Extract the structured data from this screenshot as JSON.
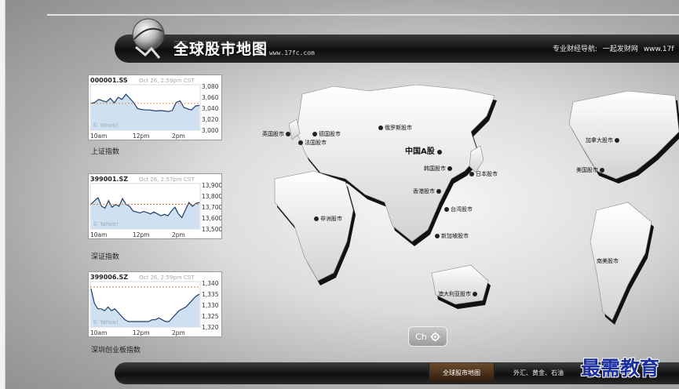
{
  "header": {
    "title": "全球股市地图",
    "url": "www.17fc.com",
    "nav_label": "专业财经导航:",
    "nav_link": "一起发财网",
    "nav_url_fragment": "www.17f"
  },
  "widgets": [
    {
      "code": "000001.SS",
      "timestamp": "Oct 26, 2:59pm CST",
      "caption": "上证指数",
      "source": "© Yahoo!",
      "y_ticks": [
        "3,080",
        "3,060",
        "3,040",
        "3,020",
        "3,000"
      ],
      "x_ticks": [
        "10am",
        "12pm",
        "2pm"
      ],
      "ref_value": 3048,
      "ylim": [
        2995,
        3085
      ],
      "series": [
        3048,
        3050,
        3056,
        3053,
        3051,
        3058,
        3049,
        3060,
        3056,
        3066,
        3058,
        3050,
        3038,
        3036,
        3035,
        3035,
        3034,
        3033,
        3034,
        3033,
        3032,
        3034,
        3050,
        3053,
        3040,
        3037,
        3035,
        3043,
        3044
      ]
    },
    {
      "code": "399001.SZ",
      "timestamp": "Oct 26, 2:57pm CST",
      "caption": "深证指数",
      "source": "© Yahoo!",
      "y_ticks": [
        "13,900",
        "13,800",
        "13,700",
        "13,600",
        "13,500"
      ],
      "x_ticks": [
        "10am",
        "12pm",
        "2pm"
      ],
      "ref_value": 13720,
      "ylim": [
        13460,
        13940
      ],
      "series": [
        13720,
        13760,
        13790,
        13700,
        13680,
        13760,
        13690,
        13720,
        13700,
        13780,
        13720,
        13700,
        13650,
        13640,
        13630,
        13645,
        13635,
        13620,
        13640,
        13620,
        13600,
        13615,
        13600,
        13650,
        13690,
        13620,
        13580,
        13660,
        13740,
        13700,
        13730,
        13740
      ]
    },
    {
      "code": "399006.SZ",
      "timestamp": "Oct 26, 2:59pm CST",
      "caption": "深圳创业板指数",
      "source": "© Yahoo!",
      "y_ticks": [
        "1,340",
        "1,335",
        "1,330",
        "1,325",
        "1,320"
      ],
      "x_ticks": [
        "10am",
        "12pm",
        "2pm"
      ],
      "ref_value": 1339,
      "ylim": [
        1317,
        1342
      ],
      "series": [
        1338,
        1330,
        1327,
        1327,
        1326,
        1328,
        1326,
        1327,
        1325,
        1323,
        1321,
        1320,
        1320,
        1320,
        1320,
        1320,
        1320,
        1320,
        1321,
        1321,
        1322,
        1321,
        1320,
        1320,
        1322,
        1324,
        1326,
        1327,
        1328,
        1330,
        1332,
        1334,
        1335
      ]
    }
  ],
  "map": {
    "labels": {
      "uk": "英国股市",
      "germany": "德国股市",
      "france": "法国股市",
      "russia": "俄罗斯股市",
      "china": "中国A股",
      "korea": "韩国股市",
      "japan": "日本股市",
      "hongkong": "香港股市",
      "taiwan": "台湾股市",
      "singapore": "新加坡股市",
      "africa": "非洲股市",
      "australia": "澳大利亚股市",
      "canada": "加拿大股市",
      "usa": "美国股市",
      "southamerica": "南美股市"
    }
  },
  "controls": {
    "lang_button": "Ch",
    "gear": "gear-icon"
  },
  "footer": {
    "active_tab": "全球股市地图",
    "other_tab": "外汇、黄金、石油"
  },
  "watermark": "最需教育"
}
